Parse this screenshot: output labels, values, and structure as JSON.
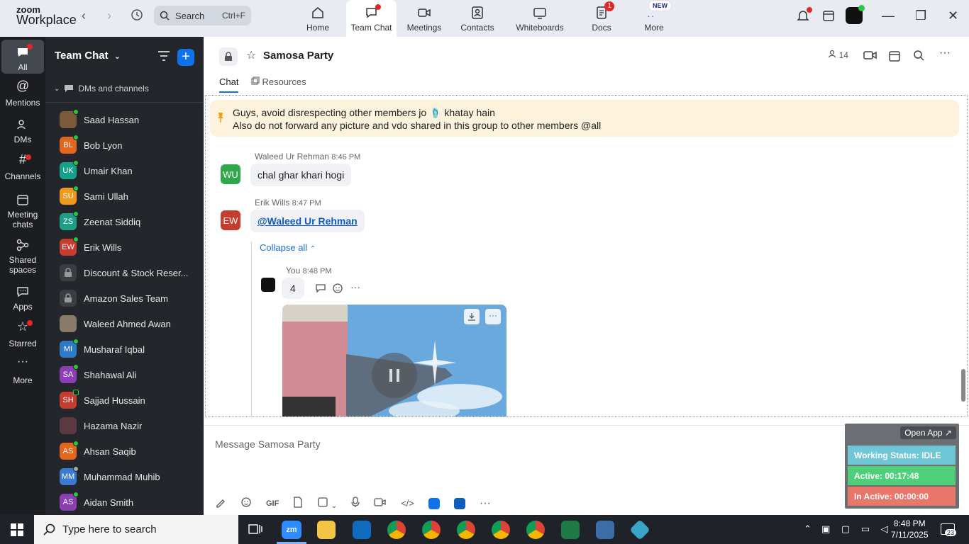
{
  "app": {
    "logo_line1": "zoom",
    "logo_line2": "Workplace"
  },
  "search": {
    "label": "Search",
    "shortcut": "Ctrl+F"
  },
  "tabs": [
    {
      "label": "Home"
    },
    {
      "label": "Team Chat"
    },
    {
      "label": "Meetings"
    },
    {
      "label": "Contacts"
    },
    {
      "label": "Whiteboards"
    },
    {
      "label": "Docs",
      "badge": "1"
    },
    {
      "label": "More",
      "badge": "NEW"
    }
  ],
  "rail": [
    {
      "label": "All"
    },
    {
      "label": "Mentions"
    },
    {
      "label": "DMs"
    },
    {
      "label": "Channels"
    },
    {
      "label": "Meeting chats"
    },
    {
      "label": "Shared spaces"
    },
    {
      "label": "Apps"
    },
    {
      "label": "Starred"
    },
    {
      "label": "More"
    }
  ],
  "sidebar": {
    "title": "Team Chat",
    "section": "DMs and channels",
    "items": [
      {
        "name": "Saad Hassan",
        "initials": "",
        "color": "#7a5a3a"
      },
      {
        "name": "Bob Lyon",
        "initials": "BL",
        "color": "#e3661d"
      },
      {
        "name": "Umair Khan",
        "initials": "UK",
        "color": "#15a28a"
      },
      {
        "name": "Sami Ullah",
        "initials": "SU",
        "color": "#f09a1c"
      },
      {
        "name": "Zeenat Siddiq",
        "initials": "ZS",
        "color": "#1e9e86"
      },
      {
        "name": "Erik Wills",
        "initials": "EW",
        "color": "#c63d2f"
      },
      {
        "name": "Discount & Stock Reser...",
        "initials": "",
        "color": "#3a3d42"
      },
      {
        "name": "Amazon Sales Team",
        "initials": "",
        "color": "#3a3d42"
      },
      {
        "name": "Waleed Ahmed Awan",
        "initials": "",
        "color": "#8a7a6a"
      },
      {
        "name": "Musharaf Iqbal",
        "initials": "MI",
        "color": "#2d7bc8"
      },
      {
        "name": "Shahawal Ali",
        "initials": "SA",
        "color": "#8b3fb3"
      },
      {
        "name": "Sajjad Hussain",
        "initials": "SH",
        "color": "#c63d2f"
      },
      {
        "name": "Hazama Nazir",
        "initials": "",
        "color": "#5a3a40"
      },
      {
        "name": "Ahsan Saqib",
        "initials": "AS",
        "color": "#e3661d"
      },
      {
        "name": "Muhammad Muhib",
        "initials": "MM",
        "color": "#3a7bd0"
      },
      {
        "name": "Aidan Smith",
        "initials": "AS",
        "color": "#8b3fb3"
      }
    ]
  },
  "chat": {
    "title": "Samosa Party",
    "members": "14",
    "subtabs": [
      "Chat",
      "Resources"
    ],
    "pinned_line1": "Guys, avoid disrespecting other members jo 🩴 khatay hain",
    "pinned_line2": "Also do not forward any picture and vdo shared in this group to other members @all",
    "msg1": {
      "initials": "WU",
      "color": "#2ea84a",
      "author": "Waleed Ur Rehman",
      "time": "8:46 PM",
      "text": "chal ghar khari hogi"
    },
    "msg2": {
      "initials": "EW",
      "color": "#c63d2f",
      "author": "Erik Wills",
      "time": "8:47 PM",
      "text": "@Waleed Ur Rehman"
    },
    "collapse": "Collapse all",
    "reply": {
      "author": "You",
      "time": "8:48 PM",
      "text": "4"
    }
  },
  "composer": {
    "placeholder": "Message Samosa Party",
    "gif": "GIF"
  },
  "status_widget": {
    "open_app": "Open App ↗",
    "working": "Working Status: IDLE",
    "active": "Active: 00:17:48",
    "inactive": "In Active: 00:00:00"
  },
  "taskbar": {
    "search": "Type here to search",
    "time": "8:48 PM",
    "date": "7/11/2025",
    "notif": "23"
  }
}
